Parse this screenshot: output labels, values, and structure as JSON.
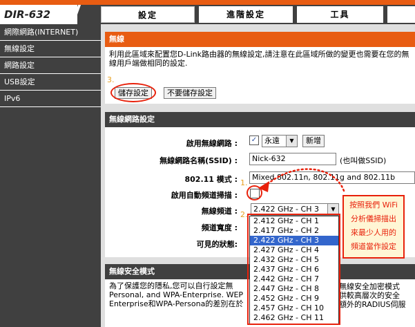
{
  "header": {
    "logo": "DIR-632",
    "tabs": [
      "設定",
      "進階設定",
      "工具"
    ]
  },
  "sidebar": {
    "items": [
      "網際網路(INTERNET)",
      "無線設定",
      "網路設定",
      "USB設定",
      "IPv6"
    ]
  },
  "panel_wireless": {
    "title": "無線",
    "description": "利用此區域來配置您D-Link路由器的無線設定,請注意在此區域所做的變更也需要在您的無線用戶端做相同的設定.",
    "step3": "3.",
    "save_label": "儲存設定",
    "nosave_label": "不要儲存設定"
  },
  "panel_network": {
    "title": "無線網路設定",
    "enable_label": "啟用無線網路 :",
    "enable_schedule": "永遠",
    "add_label": "新增",
    "ssid_label": "無線網路名稱(SSID) :",
    "ssid_value": "Nick-632",
    "ssid_hint": "(也叫做SSID)",
    "mode_label": "802.11 模式 :",
    "mode_value": "Mixed 802.11n, 802.11g and 802.11b",
    "autoscan_label": "啟用自動頻道掃描 :",
    "step1": "1.",
    "channel_label": "無線頻道 :",
    "channel_value": "2.422 GHz - CH 3",
    "step2": "2.",
    "width_label": "頻道寬度 :",
    "visible_label": "可見的狀態:",
    "channel_options": [
      "2.412 GHz - CH 1",
      "2.417 GHz - CH 2",
      "2.422 GHz - CH 3",
      "2.427 GHz - CH 4",
      "2.432 GHz - CH 5",
      "2.437 GHz - CH 6",
      "2.442 GHz - CH 7",
      "2.447 GHz - CH 8",
      "2.452 GHz - CH 9",
      "2.457 GHz - CH 10",
      "2.462 GHz - CH 11"
    ],
    "selected_index": 2
  },
  "panel_security": {
    "title": "無線安全模式",
    "line1": "為了保護您的隱私,您可以自行設定無",
    "line1b": "種無線安全加密模式",
    "line2": "Personal, and WPA-Enterprise. WEP",
    "line2b": "提供較高層次的安全",
    "line3": "Enterprise和WPA-Persona的差別在於",
    "line3b": "過額外的RADIUS伺服"
  },
  "callout": {
    "lines": [
      "按照我們 WiFi",
      "分析儀掃描出",
      "來最少人用的",
      "頻道當作設定"
    ]
  },
  "colors": {
    "accent": "#e85c12",
    "annotation": "#e8200a",
    "selected": "#3366cc"
  }
}
